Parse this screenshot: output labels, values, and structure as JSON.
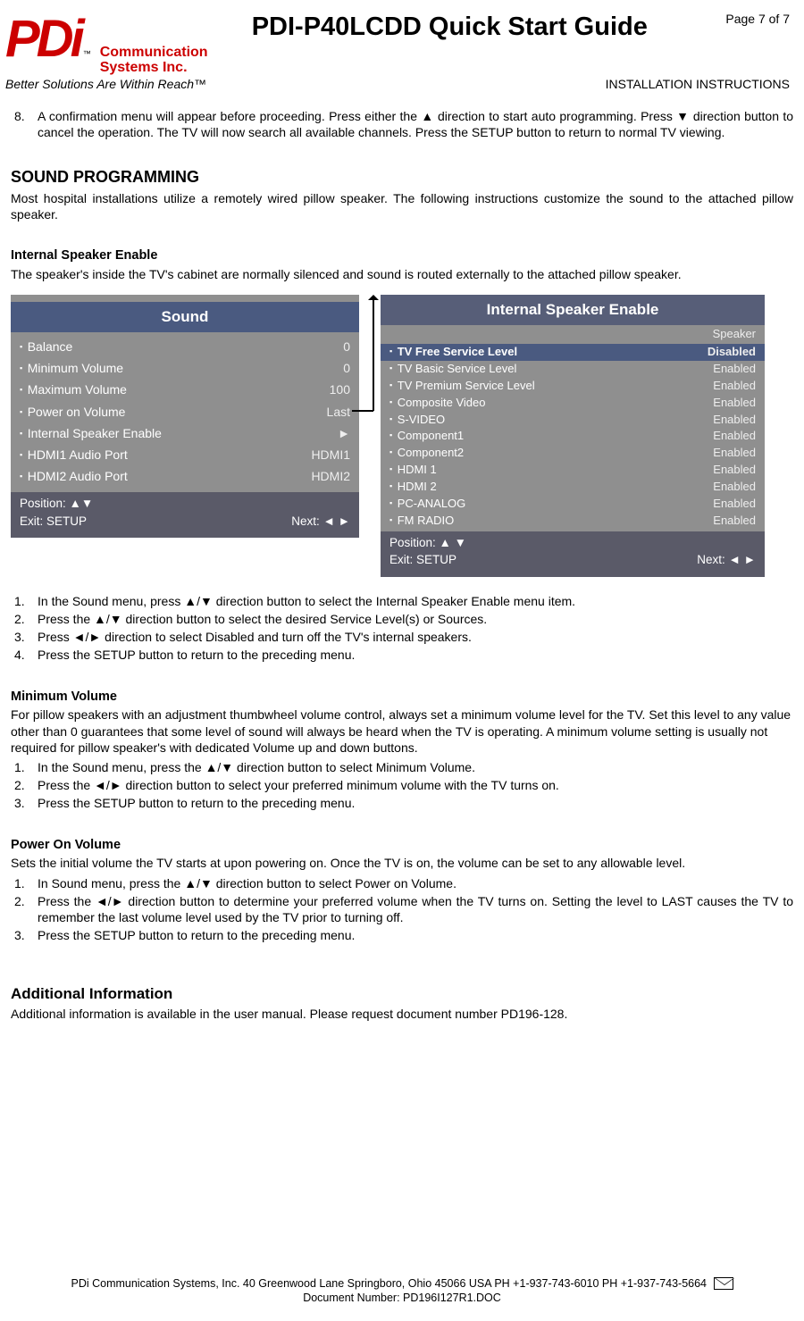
{
  "header": {
    "logo_text": "PDi",
    "logo_tm": "™",
    "company": "Communication\nSystems Inc.",
    "doc_title": "PDI-P40LCDD Quick Start Guide",
    "page_of": "Page 7 of 7",
    "tagline": "Better Solutions Are Within Reach™",
    "install": "INSTALLATION INSTRUCTIONS"
  },
  "step8": {
    "num": "8.",
    "text": "A confirmation menu will appear before proceeding.  Press either the ▲ direction to start auto programming.  Press ▼ direction button to cancel the operation.  The TV will now search all available channels. Press the SETUP button to return to normal TV viewing."
  },
  "sound_prog": {
    "title": "SOUND PROGRAMMING",
    "intro": "Most hospital installations utilize a remotely wired pillow speaker.  The following instructions customize the sound to the attached pillow speaker."
  },
  "ise": {
    "title": "Internal Speaker Enable",
    "intro": "The speaker's inside the TV's cabinet are normally silenced and sound is routed externally to the attached pillow speaker."
  },
  "menu_left": {
    "title": "Sound",
    "items": [
      {
        "label": "Balance",
        "value": "0"
      },
      {
        "label": "Minimum Volume",
        "value": "0"
      },
      {
        "label": "Maximum Volume",
        "value": "100"
      },
      {
        "label": "Power on Volume",
        "value": "Last"
      },
      {
        "label": "Internal Speaker Enable",
        "value": "►"
      },
      {
        "label": "HDMI1 Audio Port",
        "value": "HDMI1"
      },
      {
        "label": "HDMI2 Audio Port",
        "value": "HDMI2"
      }
    ],
    "footer_pos": "Position:  ▲▼",
    "footer_exit": "Exit: SETUP",
    "footer_next": "Next: ◄ ►"
  },
  "menu_right": {
    "title": "Internal Speaker Enable",
    "subhead": "Speaker",
    "items": [
      {
        "label": "TV Free Service Level",
        "value": "Disabled",
        "sel": true
      },
      {
        "label": "TV Basic Service Level",
        "value": "Enabled"
      },
      {
        "label": "TV Premium Service Level",
        "value": "Enabled"
      },
      {
        "label": "Composite Video",
        "value": "Enabled"
      },
      {
        "label": "S-VIDEO",
        "value": "Enabled"
      },
      {
        "label": "Component1",
        "value": "Enabled"
      },
      {
        "label": "Component2",
        "value": "Enabled"
      },
      {
        "label": "HDMI 1",
        "value": "Enabled"
      },
      {
        "label": "HDMI 2",
        "value": "Enabled"
      },
      {
        "label": "PC-ANALOG",
        "value": "Enabled"
      },
      {
        "label": "FM RADIO",
        "value": "Enabled"
      }
    ],
    "footer_pos": "Position: ▲ ▼",
    "footer_exit": "Exit: SETUP",
    "footer_next": "Next: ◄ ►"
  },
  "ise_steps": [
    {
      "num": "1.",
      "text": "In the Sound menu, press ▲/▼ direction button to select the Internal Speaker Enable menu item."
    },
    {
      "num": "2.",
      "text": "Press the ▲/▼ direction button to select the desired Service Level(s) or Sources."
    },
    {
      "num": "3.",
      "text": "Press ◄/► direction to select Disabled and turn off the TV's internal speakers."
    },
    {
      "num": "4.",
      "text": "Press the SETUP button to return to the preceding menu."
    }
  ],
  "min_vol": {
    "title": "Minimum Volume",
    "intro": "For pillow speakers with an adjustment thumbwheel volume control, always set a minimum volume level for the TV.  Set this level to any value other than 0 guarantees that some level of sound will always be heard when the TV is operating.  A minimum volume setting is usually not required for pillow speaker's with dedicated Volume up and down buttons.",
    "steps": [
      {
        "num": "1.",
        "text": "In the Sound menu, press the ▲/▼ direction button to select Minimum Volume."
      },
      {
        "num": "2.",
        "text": "Press the ◄/► direction button to select your preferred minimum volume with the TV turns on."
      },
      {
        "num": "3.",
        "text": "Press the SETUP button to return to the preceding menu."
      }
    ]
  },
  "pow_vol": {
    "title": "Power On Volume",
    "intro": "Sets the initial volume the TV starts at upon powering on. Once the TV is on, the volume can be set to any allowable level.",
    "steps": [
      {
        "num": "1.",
        "text": "In Sound menu, press the ▲/▼ direction button to select Power on Volume."
      },
      {
        "num": "2.",
        "text": "Press the ◄/► direction button to determine your preferred volume when the TV turns on. Setting the level to LAST causes the TV to remember the last volume level used by the TV prior to turning off."
      },
      {
        "num": "3.",
        "text": "Press the SETUP button to return to the preceding menu."
      }
    ]
  },
  "addl": {
    "title": "Additional Information",
    "text": "Additional information is available in the user manual.  Please request document number PD196-128."
  },
  "footer": {
    "line1": "PDi Communication Systems, Inc.   40 Greenwood Lane   Springboro, Ohio 45066 USA   PH +1-937-743-6010  PH +1-937-743-5664",
    "line2": "Document Number:  PD196I127R1.DOC"
  }
}
